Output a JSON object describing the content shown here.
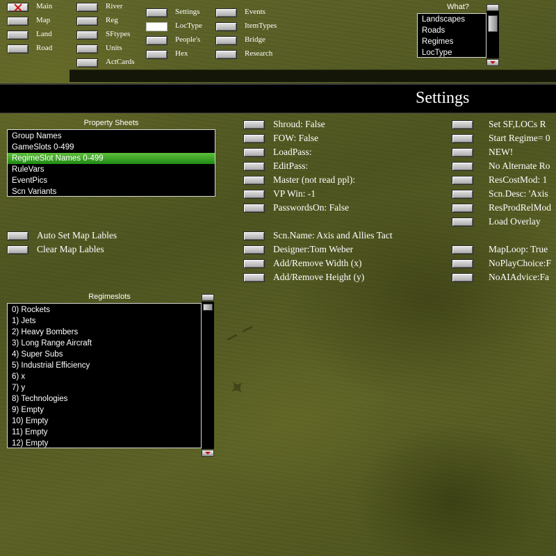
{
  "top_nav": {
    "col1": [
      "Main",
      "Map",
      "Land",
      "Road"
    ],
    "col2": [
      "River",
      "Reg",
      "SFtypes",
      "Units",
      "ActCards"
    ],
    "col3": [
      "Settings",
      "LocType",
      "People's",
      "Hex"
    ],
    "col4": [
      "Events",
      "ItemTypes",
      "Bridge",
      "Research"
    ]
  },
  "what_list": {
    "title": "What?",
    "items": [
      "Landscapes",
      "Roads",
      "Regimes",
      "LocType"
    ]
  },
  "page_title": "Settings",
  "property_sheets": {
    "title": "Property Sheets",
    "items": [
      "Group Names",
      "GameSlots 0-499",
      "RegimeSlot Names 0-499",
      "RuleVars",
      "EventPics",
      "Scn Variants"
    ],
    "selected_index": 2
  },
  "map_label_buttons": [
    "Auto Set Map Lables",
    "Clear Map Lables"
  ],
  "settings_col1": [
    "Shroud: False",
    "FOW: False",
    "LoadPass:",
    "EditPass:",
    "Master (not read ppl):",
    "VP Win: -1",
    "PasswordsOn: False"
  ],
  "settings_col1b": [
    "Scn.Name: Axis and Allies Tact",
    "Designer:Tom Weber",
    "Add/Remove Width (x)",
    "Add/Remove Height (y)"
  ],
  "settings_col2": [
    "Set SF,LOCs R",
    "Start Regime= 0",
    "NEW!",
    "No Alternate Ro",
    "ResCostMod:  1",
    "Scn.Desc:  'Axis",
    "ResProdRelMod",
    "Load Overlay"
  ],
  "settings_col2b": [
    "MapLoop: True",
    "NoPlayChoice:F",
    "NoAIAdvice:Fa"
  ],
  "regimeslots": {
    "title": "Regimeslots",
    "items": [
      "0) Rockets",
      "1) Jets",
      "2) Heavy Bombers",
      "3) Long Range Aircraft",
      "4) Super Subs",
      "5) Industrial Efficiency",
      "6) x",
      "7) y",
      "8) Technologies",
      "9) Empty",
      "10) Empty",
      "11) Empty",
      "12) Empty"
    ]
  },
  "icons": {
    "close": "close-x-icon",
    "scroll_up": "scroll-up-icon",
    "scroll_down": "scroll-down-icon"
  },
  "colors": {
    "selection_green": "#2a9a1e",
    "close_red": "#d01010"
  }
}
